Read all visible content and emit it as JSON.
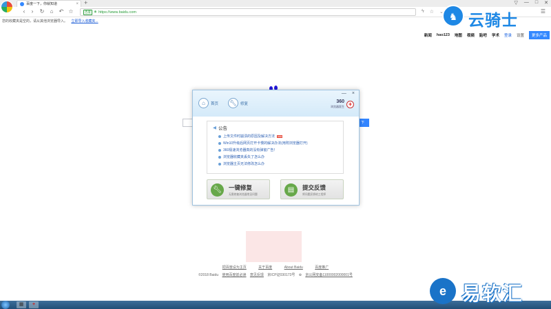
{
  "browser": {
    "tab_title": "百度一下，你就知道",
    "tab_close": "×",
    "new_tab": "+",
    "address_secure": "百度",
    "address_url": "https://www.baidu.com",
    "window_controls": [
      "▽",
      "—",
      "□",
      "✕"
    ],
    "menu": "☰"
  },
  "infobar": {
    "text": "您的收藏夹是空的，请从其他浏览器导入。",
    "link": "立即导入收藏夹..."
  },
  "baidu": {
    "nav": [
      "新闻",
      "hao123",
      "地图",
      "视频",
      "贴吧",
      "学术"
    ],
    "login": "登录",
    "settings": "设置",
    "more": "更多产品",
    "search_btn": "下",
    "footer_links": [
      "把百度设为主页",
      "关于百度",
      "About Baidu",
      "百度推广"
    ],
    "footer_copy": [
      "©2018 Baidu",
      "使用百度前必读",
      "意见反馈",
      "京ICP证030173号",
      "京公网安备11000002000001号"
    ]
  },
  "dialog": {
    "controls": [
      "—",
      "×"
    ],
    "tab_home": "首页",
    "tab_repair": "修复",
    "brand_num": "360",
    "brand_sub": "浏览器医生",
    "notice_title": "公告",
    "notice_items": [
      "上传文件时崩溃的原因及解决方法",
      "Win10升级后网页打开卡慢的解决办法(用附浏览器打开)",
      "360极速浏览器真的没有弹窗广告！",
      "浏览器收藏夹丢失了怎么办",
      "浏览器主页无法修改怎么办"
    ],
    "new_badge": "new",
    "repair_label": "一键修复",
    "repair_sub": "无需修复浏览器常见问题",
    "feedback_label": "提交反馈",
    "feedback_sub": "将问题反馈给工程师"
  },
  "watermarks": {
    "top_text": "云骑士",
    "bottom_text": "易软汇"
  },
  "colors": {
    "baidu_blue": "#3385ff",
    "dialog_header": "#d4eaf9",
    "repair_green": "#67a84a"
  }
}
